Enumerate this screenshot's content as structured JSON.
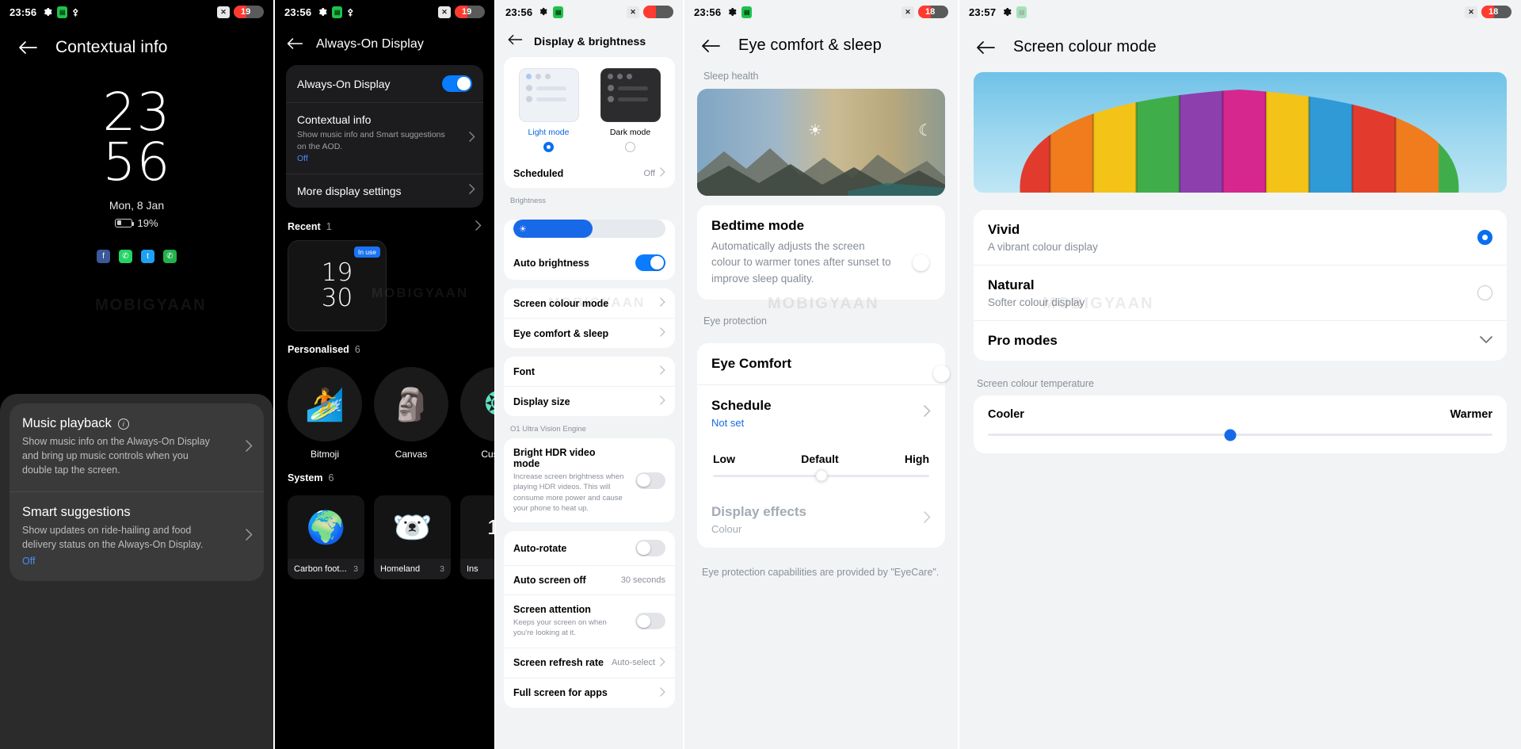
{
  "panel1": {
    "status": {
      "clock": "23:56",
      "icons": [
        "gear-icon",
        "green-app-icon",
        "bluetooth-icon"
      ],
      "right_icons": [
        "x-icon"
      ],
      "battery": "19"
    },
    "title": "Contextual info",
    "back_icon": "back-arrow-icon",
    "aod": {
      "hours": "23",
      "minutes": "56",
      "date": "Mon, 8 Jan",
      "battery_percent": "19%"
    },
    "app_icons": [
      "facebook-icon",
      "whatsapp-icon",
      "twitter-icon",
      "phone-icon"
    ],
    "watermark": "MOBIGYAAN",
    "rows": [
      {
        "title": "Music playback",
        "info_icon": "info-icon",
        "desc": "Show music info on the Always-On Display and bring up music controls when you double tap the screen.",
        "state": ""
      },
      {
        "title": "Smart suggestions",
        "desc": "Show updates on ride-hailing and food delivery status on the Always-On Display.",
        "state": "Off"
      }
    ]
  },
  "panel2": {
    "status": {
      "clock": "23:56",
      "battery": "19"
    },
    "title": "Always-On Display",
    "card": [
      {
        "title": "Always-On Display",
        "type": "toggle",
        "toggle": "on"
      },
      {
        "title": "Contextual info",
        "desc": "Show music info and Smart suggestions on the AOD.",
        "state": "Off",
        "type": "chevron"
      },
      {
        "title": "More display settings",
        "type": "chevron"
      }
    ],
    "sections": [
      {
        "label": "Recent",
        "count": "1"
      },
      {
        "label": "Personalised",
        "count": "6"
      },
      {
        "label": "System",
        "count": "6"
      }
    ],
    "recent_tile": {
      "badge": "In use",
      "line1": "19",
      "line2": "30"
    },
    "personalised": [
      {
        "label": "Bitmoji",
        "icon": "bitmoji-icon"
      },
      {
        "label": "Canvas",
        "icon": "canvas-face-icon"
      },
      {
        "label": "Custom",
        "icon": "custom-pattern-icon"
      }
    ],
    "system": [
      {
        "label": "Carbon foot...",
        "count": "3",
        "icon": "earth-icon"
      },
      {
        "label": "Homeland",
        "count": "3",
        "icon": "polar-bear-icon"
      },
      {
        "label": "Ins",
        "count": "",
        "icon": "clock-icon"
      }
    ],
    "watermark": "MOBIGYAAN"
  },
  "panel3": {
    "status": {
      "clock": "23:56",
      "battery": ""
    },
    "title": "Display & brightness",
    "modes": [
      {
        "label": "Light mode",
        "selected": true
      },
      {
        "label": "Dark mode",
        "selected": false
      }
    ],
    "scheduled": {
      "label": "Scheduled",
      "value": "Off"
    },
    "brightness_label": "Brightness",
    "brightness_percent": 52,
    "auto_brightness": {
      "label": "Auto brightness",
      "toggle": "on"
    },
    "links": [
      {
        "label": "Screen colour mode"
      },
      {
        "label": "Eye comfort & sleep"
      }
    ],
    "links2": [
      {
        "label": "Font"
      },
      {
        "label": "Display size"
      }
    ],
    "engine_label": "O1 Ultra Vision Engine",
    "hdr": {
      "title": "Bright HDR video mode",
      "desc": "Increase screen brightness when playing HDR videos. This will consume more power and cause your phone to heat up.",
      "toggle": "off"
    },
    "bottom_rows": [
      {
        "label": "Auto-rotate",
        "type": "toggle",
        "toggle": "off"
      },
      {
        "label": "Auto screen off",
        "value": "30 seconds",
        "type": "value"
      },
      {
        "label": "Screen attention",
        "desc": "Keeps your screen on when you're looking at it.",
        "type": "toggle",
        "toggle": "off"
      },
      {
        "label": "Screen refresh rate",
        "value": "Auto-select",
        "type": "chevron"
      },
      {
        "label": "Full screen for apps",
        "type": "chevron"
      }
    ],
    "watermark": "MOBIGYAAN"
  },
  "panel4": {
    "status": {
      "clock": "23:56",
      "battery": "18"
    },
    "title": "Eye comfort & sleep",
    "sleep_health_label": "Sleep health",
    "hero": {
      "sun_icon": "sun-icon",
      "moon_icon": "moon-icon"
    },
    "bedtime": {
      "title": "Bedtime mode",
      "desc": "Automatically adjusts the screen colour to warmer tones after sunset to improve sleep quality.",
      "toggle": "on"
    },
    "eye_protection_label": "Eye protection",
    "eye_comfort": {
      "title": "Eye Comfort",
      "toggle": "off"
    },
    "schedule": {
      "title": "Schedule",
      "value": "Not set"
    },
    "levels": {
      "low": "Low",
      "default": "Default",
      "high": "High",
      "position": 50
    },
    "display_effects": {
      "title": "Display effects",
      "value": "Colour"
    },
    "footer": "Eye protection capabilities are provided by \"EyeCare\".",
    "watermark": "MOBIGYAAN"
  },
  "panel5": {
    "status": {
      "clock": "23:57",
      "battery": "18"
    },
    "title": "Screen colour mode",
    "preview_icon": "parachute-image",
    "modes": [
      {
        "title": "Vivid",
        "desc": "A vibrant colour display",
        "selected": true
      },
      {
        "title": "Natural",
        "desc": "Softer colour display",
        "selected": false
      }
    ],
    "pro_modes": {
      "title": "Pro modes",
      "chevron": "chevron-down-icon"
    },
    "temperature_label": "Screen colour temperature",
    "temperature": {
      "cooler": "Cooler",
      "warmer": "Warmer",
      "position": 48
    },
    "watermark": "MOBIGYAAN"
  },
  "colors": {
    "accent": "#0a7cff",
    "link": "#1769e8",
    "battery_red": "#ff3b30",
    "green": "#1fc24b"
  }
}
